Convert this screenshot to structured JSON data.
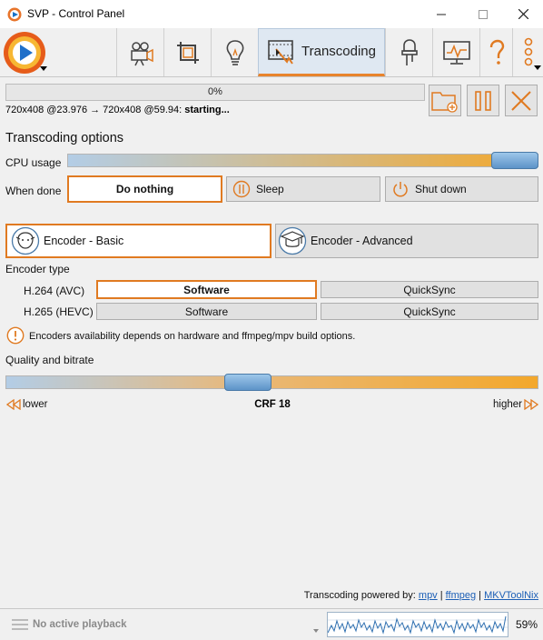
{
  "window": {
    "title": "SVP - Control Panel"
  },
  "toolbar": {
    "items": [
      {
        "icon": "video-camera-icon"
      },
      {
        "icon": "crop-icon"
      },
      {
        "icon": "lightbulb-icon"
      },
      {
        "icon": "transcoding-icon",
        "label": "Transcoding",
        "active": true
      },
      {
        "icon": "led-icon"
      },
      {
        "icon": "monitor-icon"
      },
      {
        "icon": "help-icon"
      },
      {
        "icon": "menu-dots-icon"
      }
    ]
  },
  "progress": {
    "percent_text": "0%",
    "value": 0,
    "status_source": "720x408 @23.976 → 720x408 @59.94:",
    "status_state": "starting..."
  },
  "options": {
    "section_title": "Transcoding options",
    "cpu_usage_label": "CPU usage",
    "cpu_usage_value": 1.0,
    "when_done_label": "When done",
    "when_done_options": [
      "Do nothing",
      "Sleep",
      "Shut down"
    ],
    "when_done_selected": "Do nothing"
  },
  "encoder": {
    "mode_basic": "Encoder - Basic",
    "mode_advanced": "Encoder - Advanced",
    "type_label": "Encoder type",
    "h264_label": "H.264 (AVC)",
    "h265_label": "H.265 (HEVC)",
    "software": "Software",
    "quicksync": "QuickSync",
    "notice": "Encoders availability depends on hardware and ffmpeg/mpv build options."
  },
  "quality": {
    "label": "Quality and bitrate",
    "value": 0.45,
    "lower": "lower",
    "higher": "higher",
    "crf_text": "CRF 18"
  },
  "footer": {
    "powered_prefix": "Transcoding powered by:",
    "link_mpv": "mpv",
    "link_ffmpeg": "ffmpeg",
    "link_mkvtoolnix": "MKVToolNix",
    "sep": "|",
    "no_playback": "No active playback",
    "cpu_percent": "59%"
  },
  "colors": {
    "accent": "#e07a21",
    "active_tab_bg": "#dfe8f2",
    "link": "#1c5fb6"
  }
}
